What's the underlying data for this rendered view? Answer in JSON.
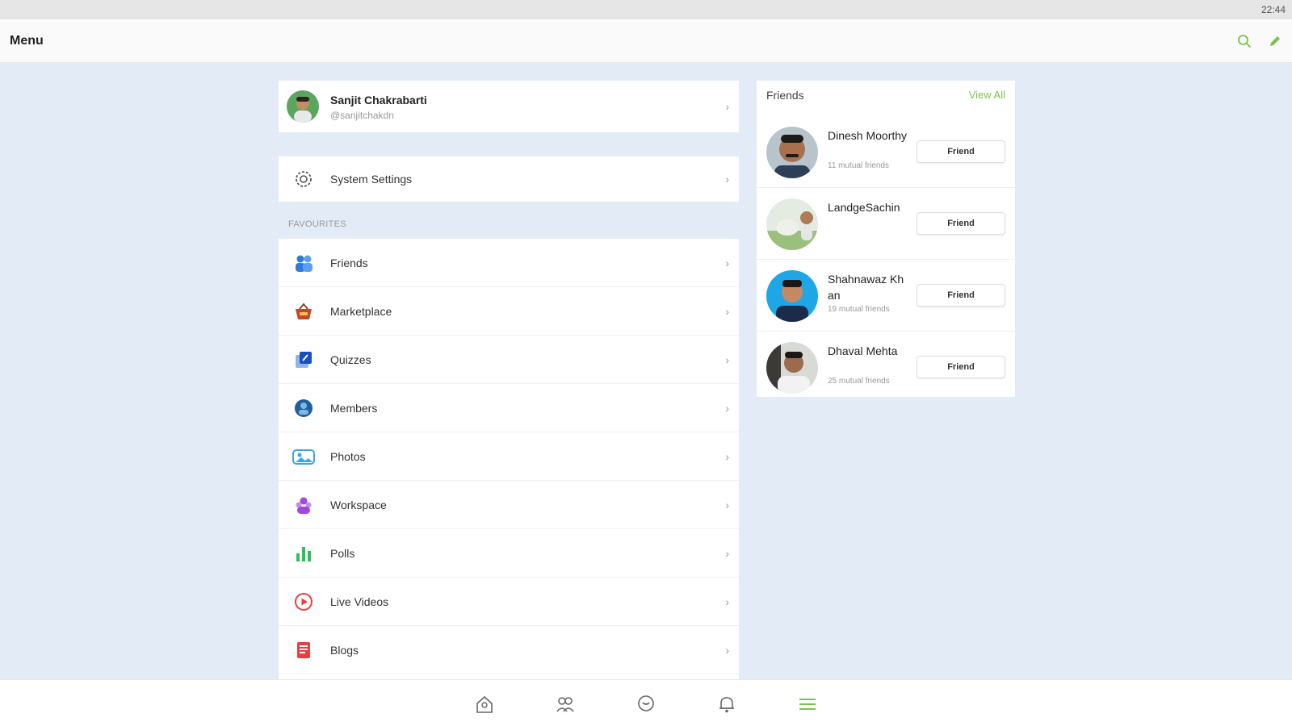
{
  "status_bar": {
    "time": "22:44"
  },
  "header": {
    "title": "Menu",
    "search_icon": "search-icon",
    "edit_icon": "pencil-icon",
    "accent": "#7cc24a"
  },
  "profile": {
    "name": "Sanjit Chakrabarti",
    "handle": "@sanjitchakdn"
  },
  "settings": {
    "label": "System Settings",
    "icon": "gear-icon"
  },
  "favourites": {
    "section_label": "FAVOURITES",
    "items": [
      {
        "label": "Friends",
        "icon": "friends-icon",
        "color": "#2f7bdc"
      },
      {
        "label": "Marketplace",
        "icon": "basket-icon",
        "color": "#c0492b"
      },
      {
        "label": "Quizzes",
        "icon": "quiz-icon",
        "color": "#1a4fc4"
      },
      {
        "label": "Members",
        "icon": "members-icon",
        "color": "#1f5f9c"
      },
      {
        "label": "Photos",
        "icon": "photos-icon",
        "color": "#3aa6e8"
      },
      {
        "label": "Workspace",
        "icon": "workspace-icon",
        "color": "#a347e0"
      },
      {
        "label": "Polls",
        "icon": "polls-icon",
        "color": "#2fbf5a"
      },
      {
        "label": "Live Videos",
        "icon": "play-icon",
        "color": "#e84040"
      },
      {
        "label": "Blogs",
        "icon": "blog-icon",
        "color": "#e84040"
      }
    ]
  },
  "friends_panel": {
    "title": "Friends",
    "view_all": "View All",
    "friends": [
      {
        "name": "Dinesh Moorthy",
        "mutual": "11 mutual friends",
        "button": "Friend"
      },
      {
        "name": "LandgeSachin",
        "mutual": "",
        "button": "Friend"
      },
      {
        "name": "Shahnawaz Khan",
        "mutual": "19 mutual friends",
        "button": "Friend"
      },
      {
        "name": "Dhaval Mehta",
        "mutual": "25 mutual friends",
        "button": "Friend"
      }
    ]
  },
  "bottom_nav": [
    {
      "icon": "home-icon",
      "active": false
    },
    {
      "icon": "friends-icon",
      "active": false
    },
    {
      "icon": "chat-icon",
      "active": false
    },
    {
      "icon": "bell-icon",
      "active": false
    },
    {
      "icon": "menu-icon",
      "active": true
    }
  ]
}
